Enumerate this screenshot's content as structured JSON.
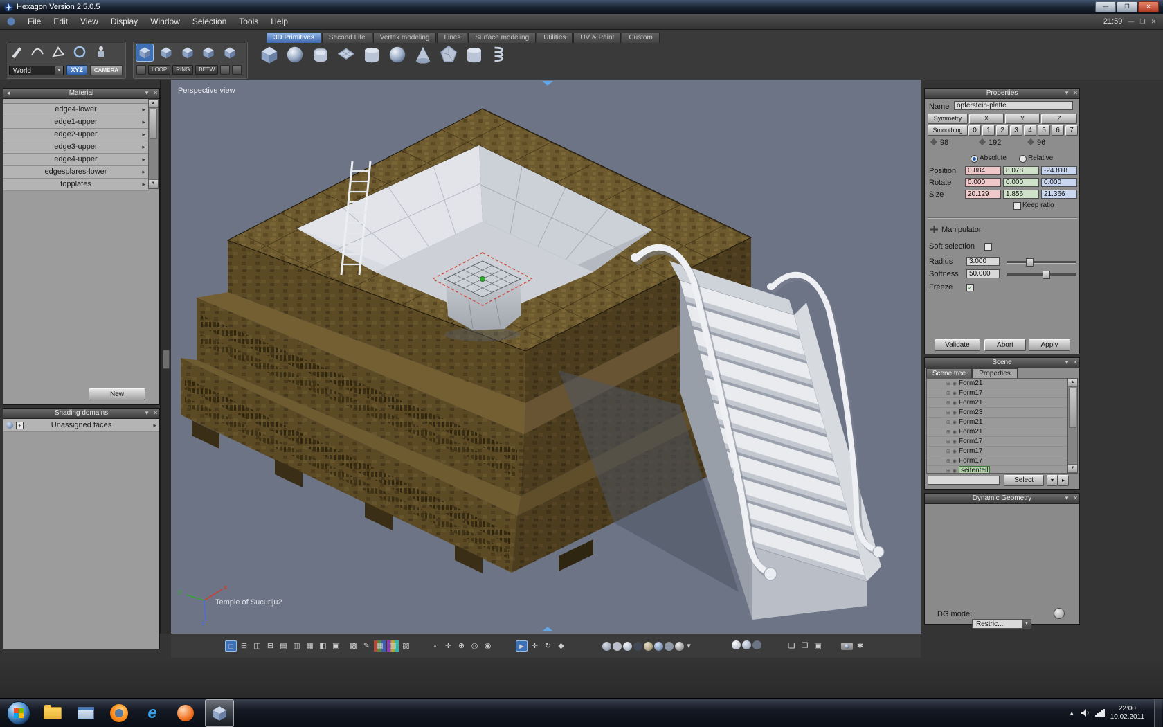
{
  "titlebar": {
    "title": "Hexagon Version 2.5.0.5"
  },
  "menubar": {
    "items": [
      "File",
      "Edit",
      "View",
      "Display",
      "Window",
      "Selection",
      "Tools",
      "Help"
    ],
    "clock": "21:59"
  },
  "tabbar": {
    "tabs": [
      "3D Primitives",
      "Second Life",
      "Vertex modeling",
      "Lines",
      "Surface modeling",
      "Utilities",
      "UV & Paint",
      "Custom"
    ]
  },
  "toolbar": {
    "world": "World",
    "xyz": "XYZ",
    "camera": "CAMERA",
    "loop": "LOOP",
    "ring": "RING",
    "betw": "BETW"
  },
  "material": {
    "title": "Material",
    "items": [
      "edge4-lower",
      "edge1-upper",
      "edge2-upper",
      "edge3-upper",
      "edge4-upper",
      "edgesplares-lower",
      "topplates"
    ],
    "new_button": "New"
  },
  "shading": {
    "title": "Shading domains",
    "unassigned": "Unassigned faces"
  },
  "viewport": {
    "label": "Perspective view",
    "caption": "Temple of Sucuriju2",
    "axis_x": "x",
    "axis_y": "y",
    "axis_z": "z"
  },
  "properties": {
    "title": "Properties",
    "name_label": "Name",
    "name_value": "opferstein-platte",
    "symmetry": "Symmetry",
    "x": "X",
    "y": "Y",
    "z": "Z",
    "smoothing": "Smoothing",
    "levels": [
      "0",
      "1",
      "2",
      "3",
      "4",
      "5",
      "6",
      "7"
    ],
    "count1": "98",
    "count2": "192",
    "count3": "96",
    "absolute": "Absolute",
    "relative": "Relative",
    "position_label": "Position",
    "position": {
      "x": "0.884",
      "y": "8.078",
      "z": "-24.818"
    },
    "rotate_label": "Rotate",
    "rotate": {
      "x": "0.000",
      "y": "0.000",
      "z": "0.000"
    },
    "size_label": "Size",
    "size": {
      "x": "20.129",
      "y": "1.856",
      "z": "21.366"
    },
    "keep_ratio": "Keep ratio",
    "manipulator": "Manipulator",
    "soft_selection": "Soft selection",
    "radius_label": "Radius",
    "radius": "3.000",
    "softness_label": "Softness",
    "softness": "50.000",
    "freeze": "Freeze",
    "validate": "Validate",
    "abort": "Abort",
    "apply": "Apply"
  },
  "scene": {
    "title": "Scene",
    "tab_tree": "Scene tree",
    "tab_props": "Properties",
    "items": [
      "Form21",
      "Form17",
      "Form21",
      "Form23",
      "Form21",
      "Form21",
      "Form17",
      "Form17",
      "Form17",
      "seitenteil"
    ],
    "select": "Select"
  },
  "dyngeo": {
    "title": "Dynamic Geometry",
    "mode_label": "DG mode:",
    "mode_value": "Restric..."
  },
  "taskbar": {
    "time": "22:00",
    "date": "10.02.2011"
  },
  "icons": {
    "close": "✕",
    "minimize": "—",
    "maximize": "❐",
    "menu_down": "▼",
    "collapse_left": "◄",
    "arrow_right": "▸",
    "scroll_up": "▲",
    "scroll_down": "▼",
    "plus": "+",
    "check": "✓",
    "dropdown_down": "▾",
    "tray_hidden": "▲",
    "ie": "e"
  },
  "bottom_toolbar": {
    "layout_glyphs": [
      "□",
      "⊞",
      "◫",
      "⊟",
      "▤",
      "▥",
      "▦",
      "◧",
      "▣"
    ],
    "paint_glyphs": [
      "▩",
      "✎",
      "▦",
      "▥",
      "▨"
    ],
    "select_glyphs": [
      "▫",
      "✛",
      "⊕",
      "◎",
      "◉"
    ],
    "tool_glyphs": [
      "►",
      "✛",
      "↻",
      "◆"
    ],
    "misc_glyphs": [
      "❏",
      "❐",
      "▣"
    ],
    "camera_glyphs": [
      "✱"
    ]
  }
}
